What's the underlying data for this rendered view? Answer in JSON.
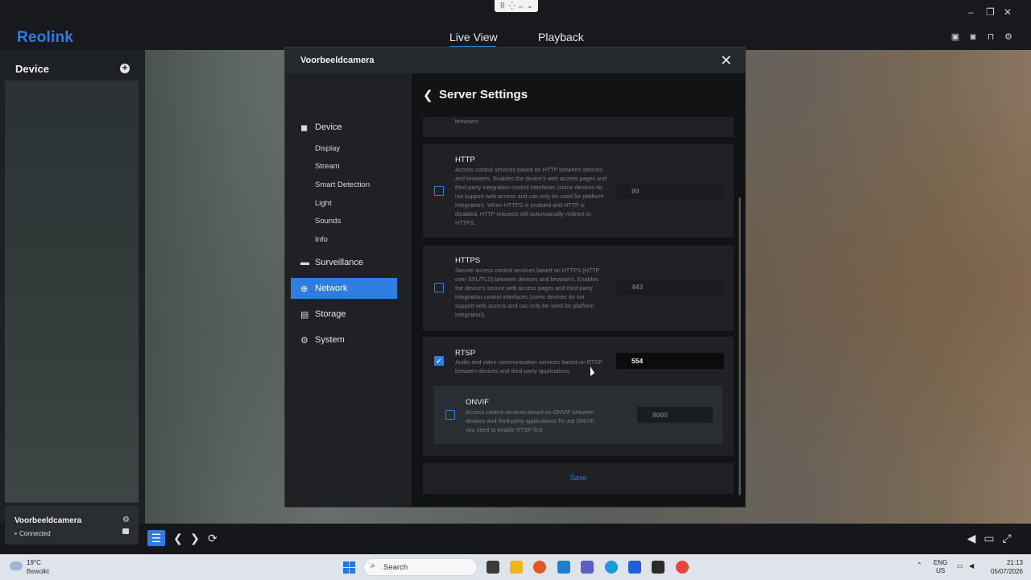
{
  "app": {
    "logo": "Reolink",
    "tabs": [
      "Live View",
      "Playback"
    ]
  },
  "window_controls": {
    "minimize": "–",
    "restore": "❐",
    "close": "✕"
  },
  "device_panel": {
    "title": "Device",
    "add": "+",
    "device_name": "Voorbeeldcamera",
    "device_status": "Connected"
  },
  "modal": {
    "title": "Voorbeeldcamera",
    "close": "✕",
    "page_title": "Server Settings",
    "back": "❮",
    "sidebar": {
      "device": "Device",
      "device_sub": [
        "Display",
        "Stream",
        "Smart Detection",
        "Light",
        "Sounds",
        "Info"
      ],
      "surveillance": "Surveillance",
      "network": "Network",
      "storage": "Storage",
      "system": "System"
    },
    "truncated_text": "browsers",
    "services": {
      "http": {
        "name": "HTTP",
        "description": "Access control services based on HTTP between devices and browsers. Enables the device's web access pages and third-party integration control interfaces (some devices do not support web access and can only be used for platform integration). When HTTPS is enabled and HTTP is disabled, HTTP requests will automatically redirect to HTTPS.",
        "port": "80",
        "enabled": false
      },
      "https": {
        "name": "HTTPS",
        "description": "Secure access control services based on HTTPS (HTTP over SSL/TLS) between devices and browsers. Enables the device's secure web access pages and third-party integration control interfaces (some devices do not support web access and can only be used for platform integration).",
        "port": "443",
        "enabled": false
      },
      "rtsp": {
        "name": "RTSP",
        "description": "Audio and video communication services based on RTSP between devices and third-party applications",
        "port": "554",
        "enabled": true
      },
      "onvif": {
        "name": "ONVIF",
        "description": "Access control services based on ONVIF between devices and third-party applications To use ONVIF, you need to enable RTSP first",
        "port": "8000",
        "enabled": false
      }
    },
    "save": "Save"
  },
  "taskbar": {
    "temperature": "19°C",
    "weather": "Bewolkt",
    "search": "Search",
    "lang": "ENG",
    "region": "US",
    "time": "21:13",
    "date": "05/07/2026"
  },
  "colors": {
    "accent": "#2f7de1",
    "background": "#16181c",
    "modal": "#1f2125",
    "content": "#121315"
  }
}
